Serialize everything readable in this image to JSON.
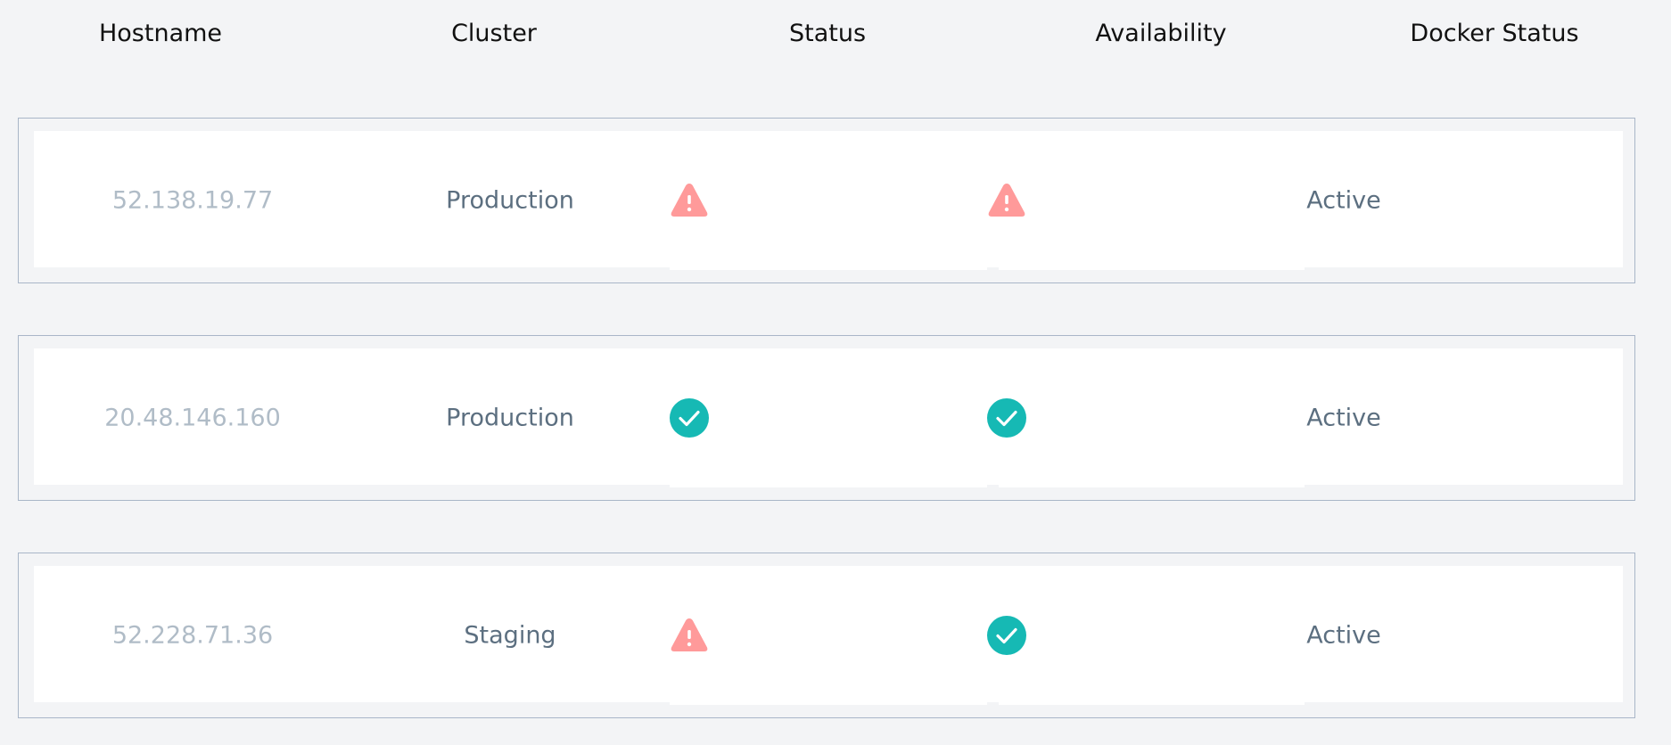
{
  "columns": {
    "hostname": "Hostname",
    "cluster": "Cluster",
    "status": "Status",
    "availability": "Availability",
    "docker_status": "Docker Status"
  },
  "rows": [
    {
      "hostname": "52.138.19.77",
      "cluster": "Production",
      "status_icon": "warning-icon",
      "availability_icon": "warning-icon",
      "docker_status": "Active"
    },
    {
      "hostname": "20.48.146.160",
      "cluster": "Production",
      "status_icon": "check-circle-icon",
      "availability_icon": "check-circle-icon",
      "docker_status": "Active"
    },
    {
      "hostname": "52.228.71.36",
      "cluster": "Staging",
      "status_icon": "warning-icon",
      "availability_icon": "check-circle-icon",
      "docker_status": "Active"
    }
  ],
  "colors": {
    "warning": "#ff9a9a",
    "success": "#16b9b4",
    "border": "#a9b6c8",
    "hostname_text": "#b0bcc7",
    "cell_text": "#5c6f80"
  }
}
